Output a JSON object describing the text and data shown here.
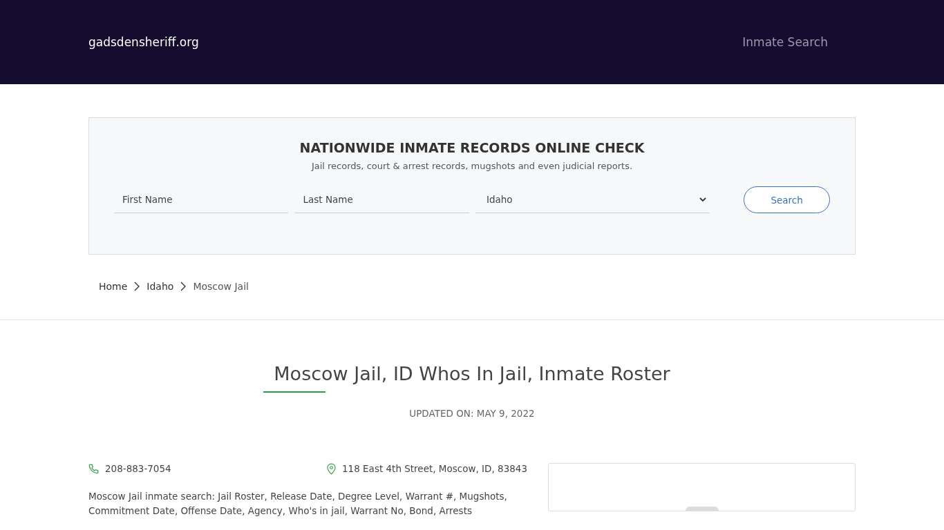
{
  "header": {
    "site": "gadsdensheriff.org",
    "nav": [
      "Inmate Search"
    ]
  },
  "search_panel": {
    "title": "NATIONWIDE INMATE RECORDS ONLINE CHECK",
    "subtitle": "Jail records, court & arrest records, mugshots and even judicial reports.",
    "first_name": {
      "placeholder": "First Name"
    },
    "last_name": {
      "placeholder": "Last Name"
    },
    "state": {
      "value": "Idaho"
    },
    "button": "Search"
  },
  "breadcrumb": [
    "Home",
    "Idaho",
    "Moscow Jail"
  ],
  "article": {
    "title": "Moscow Jail, ID Whos In Jail, Inmate Roster",
    "updated": "UPDATED ON: MAY 9, 2022",
    "phone": "208-883-7054",
    "address": "118 East 4th Street, Moscow, ID, 83843",
    "paragraph": "Moscow Jail inmate search: Jail Roster, Release Date, Degree Level, Warrant #, Mugshots, Commitment Date, Offense Date, Agency, Who's in jail, Warrant No, Bond, Arrests"
  }
}
